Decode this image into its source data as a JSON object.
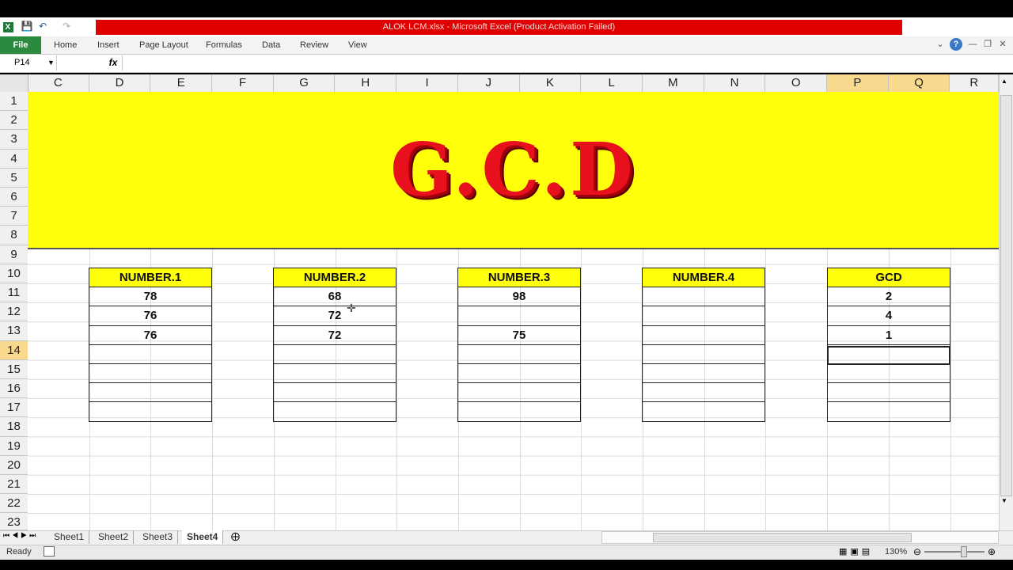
{
  "window": {
    "title": "ALOK LCM.xlsx  -  Microsoft Excel (Product Activation Failed)"
  },
  "ribbon": {
    "tabs": [
      "File",
      "Home",
      "Insert",
      "Page Layout",
      "Formulas",
      "Data",
      "Review",
      "View"
    ]
  },
  "formula_bar": {
    "name_box": "P14",
    "fx": "fx",
    "value": ""
  },
  "columns": [
    "C",
    "D",
    "E",
    "F",
    "G",
    "H",
    "I",
    "J",
    "K",
    "L",
    "M",
    "N",
    "O",
    "P",
    "Q",
    "R"
  ],
  "selected_columns": [
    "P",
    "Q"
  ],
  "rows": [
    "1",
    "2",
    "3",
    "4",
    "5",
    "6",
    "7",
    "8",
    "9",
    "10",
    "11",
    "12",
    "13",
    "14",
    "15",
    "16",
    "17",
    "18",
    "19",
    "20",
    "21",
    "22",
    "23"
  ],
  "selected_row": "14",
  "banner": {
    "title": "G.C.D",
    "bg": "#ffff0a",
    "color": "#e8101c"
  },
  "tables": [
    {
      "header": "NUMBER.1",
      "values": [
        "78",
        "76",
        "76",
        "",
        "",
        "",
        ""
      ]
    },
    {
      "header": "NUMBER.2",
      "values": [
        "68",
        "72",
        "72",
        "",
        "",
        "",
        ""
      ]
    },
    {
      "header": "NUMBER.3",
      "values": [
        "98",
        "",
        "75",
        "",
        "",
        "",
        ""
      ]
    },
    {
      "header": "NUMBER.4",
      "values": [
        "",
        "",
        "",
        "",
        "",
        "",
        ""
      ]
    },
    {
      "header": "GCD",
      "values": [
        "2",
        "4",
        "1",
        "",
        "",
        "",
        ""
      ]
    }
  ],
  "sheets": {
    "tabs": [
      "Sheet1",
      "Sheet2",
      "Sheet3",
      "Sheet4"
    ],
    "active": "Sheet4"
  },
  "status": {
    "text": "Ready",
    "zoom": "130%"
  }
}
